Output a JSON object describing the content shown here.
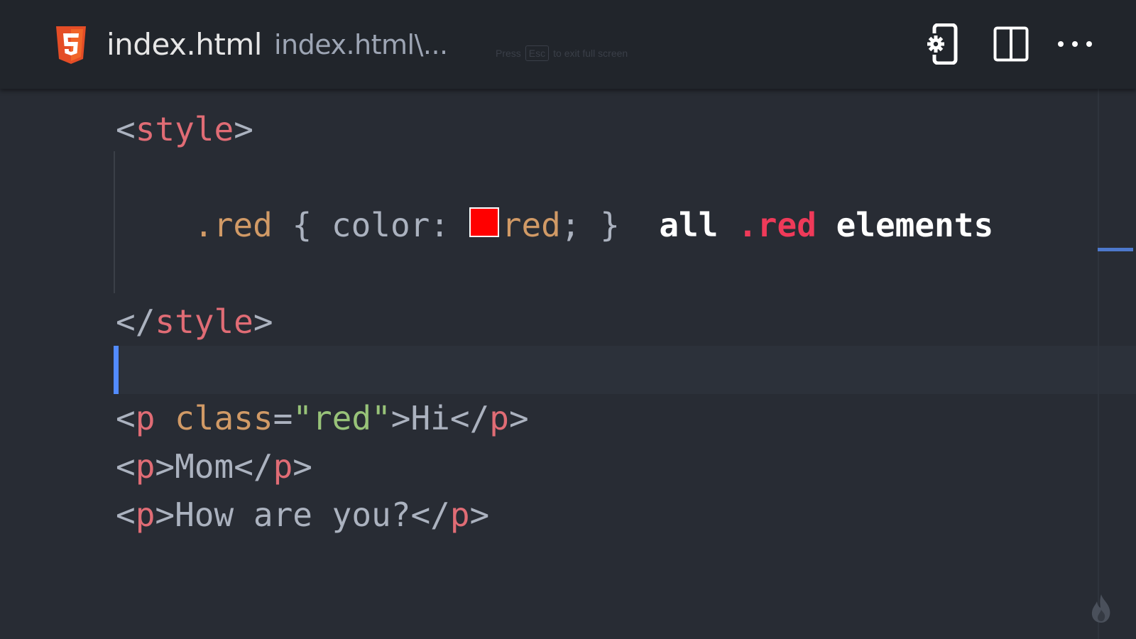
{
  "tab": {
    "icon": "html5-icon",
    "title": "index.html",
    "description": "index.html\\...",
    "hint_before": "Press",
    "hint_key": "Esc",
    "hint_after": "to exit full screen"
  },
  "toolbar": {
    "buttons": [
      "open-preview-icon",
      "split-editor-icon",
      "more-actions-icon"
    ]
  },
  "code": {
    "line1": {
      "open": "<",
      "tag": "style",
      "close": ">"
    },
    "line2": {
      "selector": ".red",
      "brace_open": " { ",
      "prop": "color: ",
      "value": "red",
      "semi": "; }",
      "annotation_pre": "all ",
      "annotation_hl": ".red",
      "annotation_post": " elements"
    },
    "line3": {
      "open": "</",
      "tag": "style",
      "close": ">"
    },
    "line5": {
      "open": "<",
      "tag": "p",
      "space": " ",
      "attr": "class",
      "eq": "=",
      "str": "\"red\"",
      "gt": ">",
      "text": "Hi",
      "close_open": "</",
      "close_tag": "p",
      "close_gt": ">"
    },
    "line6": {
      "open": "<",
      "tag": "p",
      "gt": ">",
      "text": "Mom",
      "close_open": "</",
      "close_tag": "p",
      "close_gt": ">"
    },
    "line7": {
      "open": "<",
      "tag": "p",
      "gt": ">",
      "text": "How are you?",
      "close_open": "</",
      "close_tag": "p",
      "close_gt": ">"
    }
  },
  "colors": {
    "swatch": "#ff0000",
    "cursor": "#528bff",
    "annotation_highlight": "#ef3a59"
  },
  "corner_icon": "flame-icon"
}
